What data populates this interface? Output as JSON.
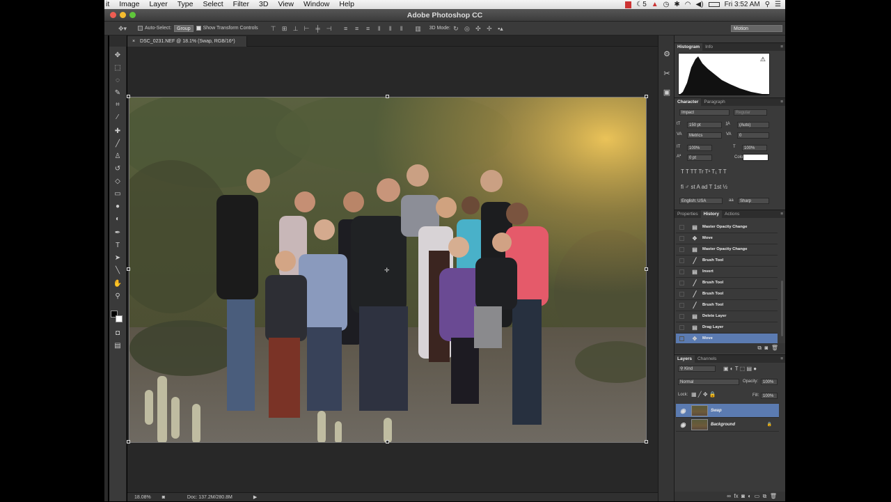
{
  "menubar": {
    "items": [
      "it",
      "Image",
      "Layer",
      "Type",
      "Select",
      "Filter",
      "3D",
      "View",
      "Window",
      "Help"
    ],
    "right": {
      "badge": "5",
      "time": "Fri 3:52 AM"
    }
  },
  "window": {
    "title": "Adobe Photoshop CC"
  },
  "options": {
    "auto_select": "Auto-Select:",
    "group": "Group",
    "show_transform": "Show Transform Controls",
    "mode3d": "3D Mode:",
    "workspace": "Motion"
  },
  "document": {
    "tab_label": "DSC_0231.NEF @ 18.1% (Swap, RGB/16*)",
    "zoom": "18.08%",
    "doc_info": "Doc: 137.2M/280.8M"
  },
  "histogram": {
    "tabs": [
      "Histogram",
      "Info"
    ],
    "warning": "⚠"
  },
  "character": {
    "tabs": [
      "Character",
      "Paragraph"
    ],
    "font": "Impact",
    "style": "Regular",
    "size": "150 pt",
    "leading": "(Auto)",
    "kerning": "Metrics",
    "tracking": "0",
    "vscale": "100%",
    "hscale": "100%",
    "baseline": "0 pt",
    "color_label": "Color:",
    "color": "#ffffff",
    "glyphs1": "T T TT Tr T¹ T₁ T T",
    "glyphs2": "fi ♂ st A ad T 1st ½",
    "language": "English: USA",
    "aa_symbol": "aa",
    "antialias": "Sharp"
  },
  "history": {
    "tabs": [
      "Properties",
      "History",
      "Actions"
    ],
    "items": [
      {
        "label": "Master Opacity Change",
        "icon": "doc"
      },
      {
        "label": "Move",
        "icon": "move"
      },
      {
        "label": "Master Opacity Change",
        "icon": "doc"
      },
      {
        "label": "Brush Tool",
        "icon": "brush"
      },
      {
        "label": "Invert",
        "icon": "doc"
      },
      {
        "label": "Brush Tool",
        "icon": "brush"
      },
      {
        "label": "Brush Tool",
        "icon": "brush"
      },
      {
        "label": "Brush Tool",
        "icon": "brush"
      },
      {
        "label": "Delete Layer",
        "icon": "doc"
      },
      {
        "label": "Drag Layer",
        "icon": "doc"
      },
      {
        "label": "Move",
        "icon": "move"
      }
    ]
  },
  "layers": {
    "tabs": [
      "Layers",
      "Channels"
    ],
    "kind": "Kind",
    "blend": "Normal",
    "opacity_label": "Opacity:",
    "opacity": "100%",
    "lock_label": "Lock:",
    "fill_label": "Fill:",
    "fill": "100%",
    "items": [
      {
        "name": "Swap",
        "selected": true
      },
      {
        "name": "Background",
        "locked": true
      }
    ]
  },
  "colors": {
    "accent_selected": "#5b7bb1",
    "panel": "#3a3a3a",
    "canvas_bg": "#282828"
  }
}
